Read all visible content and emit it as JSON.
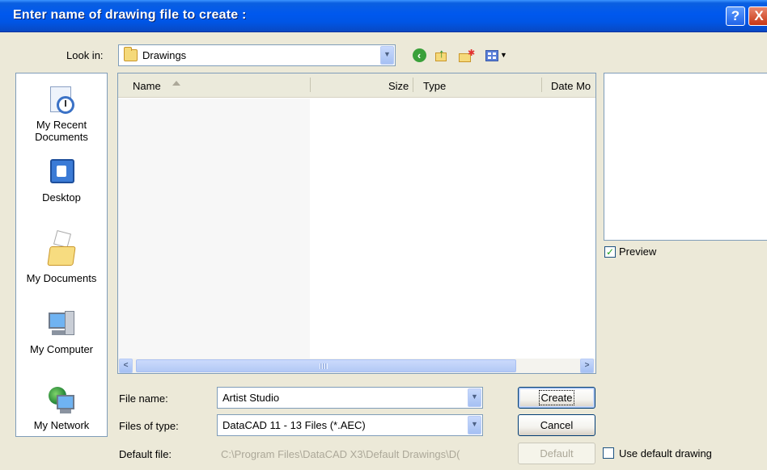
{
  "dialog": {
    "title": "Enter name of drawing file to create :",
    "help_glyph": "?",
    "close_glyph": "X"
  },
  "lookin": {
    "label": "Look in:",
    "value": "Drawings",
    "icon": "folder-icon"
  },
  "toolbar": {
    "back_icon": "back-arrow-icon",
    "up_icon": "up-folder-icon",
    "new_folder_icon": "new-folder-icon",
    "views_icon": "views-menu-icon"
  },
  "places": [
    {
      "label_line1": "My Recent",
      "label_line2": "Documents",
      "icon": "recent-documents-icon"
    },
    {
      "label_line1": "Desktop",
      "label_line2": "",
      "icon": "desktop-icon"
    },
    {
      "label_line1": "My Documents",
      "label_line2": "",
      "icon": "my-documents-icon"
    },
    {
      "label_line1": "My Computer",
      "label_line2": "",
      "icon": "my-computer-icon"
    },
    {
      "label_line1": "My Network",
      "label_line2": "",
      "icon": "my-network-icon"
    }
  ],
  "filelist": {
    "columns": [
      "Name",
      "Size",
      "Type",
      "Date Mo"
    ],
    "rows": []
  },
  "preview": {
    "label": "Preview",
    "checked": true
  },
  "filename": {
    "label": "File name:",
    "value": "Artist Studio"
  },
  "filetype": {
    "label": "Files of type:",
    "value": "DataCAD 11 - 13 Files (*.AEC)"
  },
  "defaultfile": {
    "label": "Default file:",
    "value": "C:\\Program Files\\DataCAD X3\\Default Drawings\\D("
  },
  "buttons": {
    "create": "Create",
    "cancel": "Cancel",
    "default": "Default"
  },
  "use_default": {
    "label": "Use default drawing",
    "checked": false
  },
  "colors": {
    "titlebar": "#0058ee",
    "dialog_bg": "#ece9d8",
    "border": "#7f9db9"
  }
}
